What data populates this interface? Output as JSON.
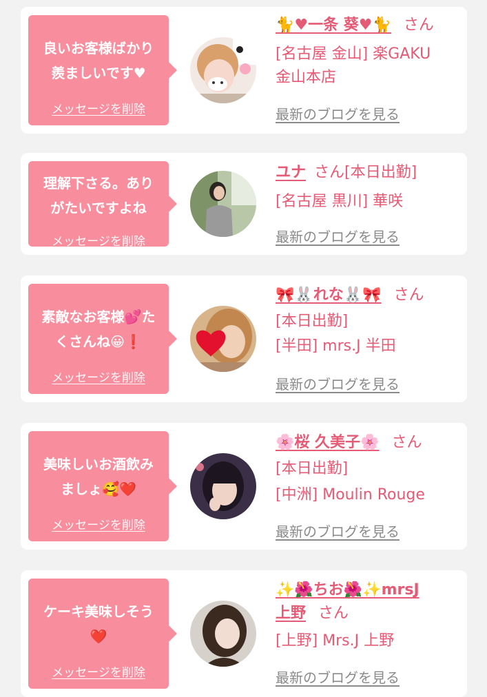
{
  "colors": {
    "page_background": "#f2f2f2",
    "card_background": "#ffffff",
    "bubble": "#f78d9d",
    "name_pink": "#e55a74",
    "link_gray": "#8a8a8a"
  },
  "delete_label": "メッセージを削除",
  "blog_label": "最新のブログを見る",
  "san_label": "さん",
  "cards": [
    {
      "message_lines": [
        "良いお客様ばかり",
        "羨ましいです♥"
      ],
      "name": "🐈♥一条 葵♥🐈",
      "name_cont": "",
      "status": "",
      "shop_lines": [
        "[名古屋 金山] 楽GAKU",
        "金山本店"
      ],
      "avatar_icon": "portrait-bear-filter-photo"
    },
    {
      "message_lines": [
        "理解下さる。あり",
        "がたいですよね"
      ],
      "name": "ユナ",
      "name_cont": "",
      "status": "[本日出勤]",
      "shop_lines": [
        "[名古屋 黒川] 華咲"
      ],
      "avatar_icon": "portrait-photo"
    },
    {
      "message_lines": [
        "素敵なお客様💕た",
        "くさんね😀❗"
      ],
      "name": "🎀🐰れな🐰🎀",
      "name_cont": "",
      "status": "[本日出勤]",
      "shop_lines": [
        "[半田] mrs.J 半田"
      ],
      "avatar_icon": "portrait-heart-sticker-photo"
    },
    {
      "message_lines": [
        "美味しいお酒飲み",
        "ましょ🥰❤️"
      ],
      "name": "🌸桜 久美子🌸",
      "name_cont": "",
      "status": "[本日出勤]",
      "shop_lines": [
        "[中洲] Moulin Rouge"
      ],
      "avatar_icon": "portrait-photo"
    },
    {
      "message_lines": [
        "ケーキ美味しそう",
        "❤️"
      ],
      "name": "✨🌺ちお🌺✨mrsJ",
      "name_cont": "上野",
      "status": "",
      "shop_lines": [
        "[上野] Mrs.J 上野"
      ],
      "avatar_icon": "portrait-photo"
    }
  ]
}
